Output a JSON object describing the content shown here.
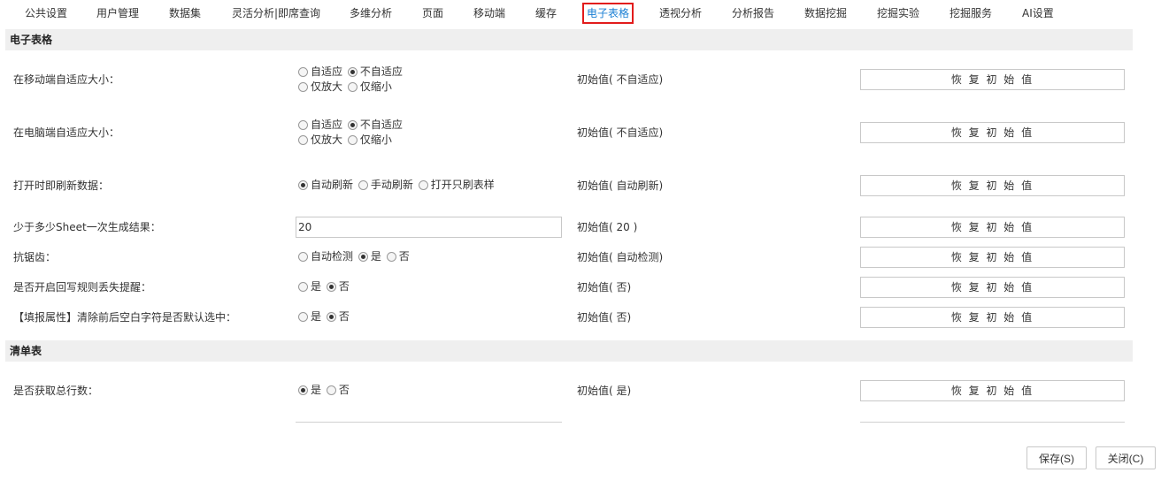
{
  "tabs": [
    "公共设置",
    "用户管理",
    "数据集",
    "灵活分析|即席查询",
    "多维分析",
    "页面",
    "移动端",
    "缓存",
    "电子表格",
    "透视分析",
    "分析报告",
    "数据挖掘",
    "挖掘实验",
    "挖掘服务",
    "AI设置"
  ],
  "active_tab": "电子表格",
  "section1": "电子表格",
  "section2": "清单表",
  "reset_label": "恢 复 初 始 值",
  "rows": {
    "mobile": {
      "label": "在移动端自适应大小：",
      "options": [
        "自适应",
        "不自适应",
        "仅放大",
        "仅缩小"
      ],
      "selected": "不自适应",
      "init": "初始值( 不自适应)"
    },
    "pc": {
      "label": "在电脑端自适应大小：",
      "options": [
        "自适应",
        "不自适应",
        "仅放大",
        "仅缩小"
      ],
      "selected": "不自适应",
      "init": "初始值( 不自适应)"
    },
    "refresh": {
      "label": "打开时即刷新数据：",
      "options": [
        "自动刷新",
        "手动刷新",
        "打开只刷表样"
      ],
      "selected": "自动刷新",
      "init": "初始值( 自动刷新)"
    },
    "sheet": {
      "label": "少于多少Sheet一次生成结果：",
      "value": "20",
      "init": "初始值( 20 )"
    },
    "antialias": {
      "label": "抗锯齿：",
      "options": [
        "自动检测",
        "是",
        "否"
      ],
      "selected": "是",
      "init": "初始值( 自动检测)"
    },
    "writeback": {
      "label": "是否开启回写规则丢失提醒：",
      "options": [
        "是",
        "否"
      ],
      "selected": "否",
      "init": "初始值( 否)"
    },
    "trim": {
      "label": "【填报属性】清除前后空白字符是否默认选中：",
      "options": [
        "是",
        "否"
      ],
      "selected": "否",
      "init": "初始值( 否)"
    },
    "total": {
      "label": "是否获取总行数：",
      "options": [
        "是",
        "否"
      ],
      "selected": "是",
      "init": "初始值( 是)"
    }
  },
  "save_label": "保存(S)",
  "close_label": "关闭(C)"
}
